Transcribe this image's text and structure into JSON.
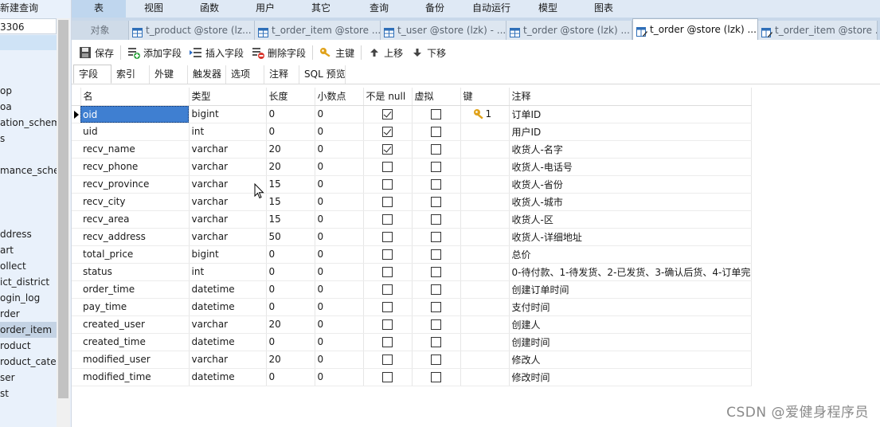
{
  "sidebar": {
    "new_query": "新建查询",
    "connection": "3306",
    "items": [
      "op",
      "oa",
      "ation_schema",
      "s",
      "",
      "mance_schem",
      "",
      "",
      "",
      "ddress",
      "art",
      "ollect",
      "ict_district",
      "ogin_log",
      "rder",
      "order_item",
      "roduct",
      "roduct_cate",
      "ser",
      "st"
    ],
    "selected_index": 15
  },
  "menu": [
    "表",
    "视图",
    "函数",
    "用户",
    "其它",
    "查询",
    "备份",
    "自动运行",
    "模型",
    "图表"
  ],
  "menu_active": "表",
  "tabs": [
    {
      "label": "对象",
      "type": "object"
    },
    {
      "label": "t_product @store (lz...",
      "type": "table"
    },
    {
      "label": "t_order_item @store ...",
      "type": "table"
    },
    {
      "label": "t_user @store (lzk) - ...",
      "type": "table"
    },
    {
      "label": "t_order @store (lzk) ...",
      "type": "table"
    },
    {
      "label": "t_order @store (lzk) ...",
      "type": "design",
      "active": true
    },
    {
      "label": "t_order_item @store ...",
      "type": "design"
    }
  ],
  "toolbar": {
    "save": "保存",
    "add_field": "添加字段",
    "insert_field": "插入字段",
    "delete_field": "删除字段",
    "primary_key": "主键",
    "move_up": "上移",
    "move_down": "下移"
  },
  "subtabs": [
    "字段",
    "索引",
    "外键",
    "触发器",
    "选项",
    "注释",
    "SQL 预览"
  ],
  "subtab_active": "字段",
  "columns": {
    "name": "名",
    "type": "类型",
    "length": "长度",
    "decimals": "小数点",
    "not_null": "不是 null",
    "virtual": "虚拟",
    "key": "键",
    "comment": "注释"
  },
  "rows": [
    {
      "name": "oid",
      "type": "bigint",
      "length": "0",
      "decimals": "0",
      "not_null": true,
      "virtual": false,
      "key": "1",
      "comment": "订单ID"
    },
    {
      "name": "uid",
      "type": "int",
      "length": "0",
      "decimals": "0",
      "not_null": true,
      "virtual": false,
      "key": "",
      "comment": "用户ID"
    },
    {
      "name": "recv_name",
      "type": "varchar",
      "length": "20",
      "decimals": "0",
      "not_null": true,
      "virtual": false,
      "key": "",
      "comment": "收货人-名字"
    },
    {
      "name": "recv_phone",
      "type": "varchar",
      "length": "20",
      "decimals": "0",
      "not_null": false,
      "virtual": false,
      "key": "",
      "comment": "收货人-电话号"
    },
    {
      "name": "recv_province",
      "type": "varchar",
      "length": "15",
      "decimals": "0",
      "not_null": false,
      "virtual": false,
      "key": "",
      "comment": "收货人-省份"
    },
    {
      "name": "recv_city",
      "type": "varchar",
      "length": "15",
      "decimals": "0",
      "not_null": false,
      "virtual": false,
      "key": "",
      "comment": "收货人-城市"
    },
    {
      "name": "recv_area",
      "type": "varchar",
      "length": "15",
      "decimals": "0",
      "not_null": false,
      "virtual": false,
      "key": "",
      "comment": "收货人-区"
    },
    {
      "name": "recv_address",
      "type": "varchar",
      "length": "50",
      "decimals": "0",
      "not_null": false,
      "virtual": false,
      "key": "",
      "comment": "收货人-详细地址"
    },
    {
      "name": "total_price",
      "type": "bigint",
      "length": "0",
      "decimals": "0",
      "not_null": false,
      "virtual": false,
      "key": "",
      "comment": "总价"
    },
    {
      "name": "status",
      "type": "int",
      "length": "0",
      "decimals": "0",
      "not_null": false,
      "virtual": false,
      "key": "",
      "comment": "0-待付款、1-待发货、2-已发货、3-确认后货、4-订单完"
    },
    {
      "name": "order_time",
      "type": "datetime",
      "length": "0",
      "decimals": "0",
      "not_null": false,
      "virtual": false,
      "key": "",
      "comment": "创建订单时间"
    },
    {
      "name": "pay_time",
      "type": "datetime",
      "length": "0",
      "decimals": "0",
      "not_null": false,
      "virtual": false,
      "key": "",
      "comment": "支付时间"
    },
    {
      "name": "created_user",
      "type": "varchar",
      "length": "20",
      "decimals": "0",
      "not_null": false,
      "virtual": false,
      "key": "",
      "comment": "创建人"
    },
    {
      "name": "created_time",
      "type": "datetime",
      "length": "0",
      "decimals": "0",
      "not_null": false,
      "virtual": false,
      "key": "",
      "comment": "创建时间"
    },
    {
      "name": "modified_user",
      "type": "varchar",
      "length": "20",
      "decimals": "0",
      "not_null": false,
      "virtual": false,
      "key": "",
      "comment": "修改人"
    },
    {
      "name": "modified_time",
      "type": "datetime",
      "length": "0",
      "decimals": "0",
      "not_null": false,
      "virtual": false,
      "key": "",
      "comment": "修改时间"
    }
  ],
  "selected_row": 0,
  "watermark": "CSDN @爱健身程序员",
  "colors": {
    "selection": "#3f7fd1",
    "menubar": "#dfe9f5",
    "tabstrip": "#c8d8ea",
    "sidebar": "#e9f1fb",
    "key_gold": "#e0a21b"
  }
}
